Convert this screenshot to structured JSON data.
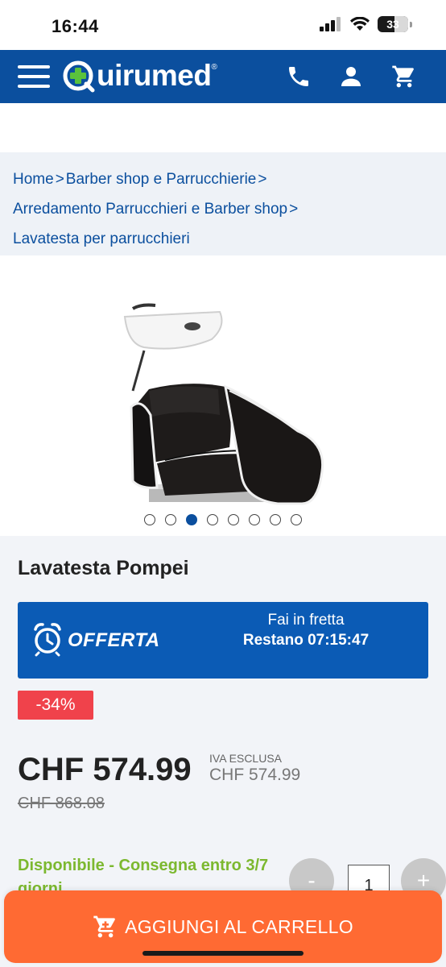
{
  "status_bar": {
    "time": "16:44",
    "battery": "33"
  },
  "header": {
    "logo_text": "uirumed",
    "logo_mark": "Q",
    "logo_reg": "®",
    "icons": [
      "menu-icon",
      "phone-icon",
      "user-icon",
      "cart-icon"
    ]
  },
  "breadcrumb": {
    "items": [
      {
        "label": "Home"
      },
      {
        "label": "Barber shop e Parrucchierie"
      },
      {
        "label": "Arredamento Parrucchieri e Barber shop"
      },
      {
        "label": "Lavatesta per parrucchieri"
      }
    ],
    "separator": ">"
  },
  "gallery": {
    "image": "salon-shampoo-chair",
    "slide_count": 8,
    "active_slide": 3
  },
  "product": {
    "title": "Lavatesta Pompei",
    "offer": {
      "label": "OFFERTA",
      "hurry": "Fai in fretta",
      "timer": "Restano 07:15:47"
    },
    "discount": "-34%",
    "price": "CHF 574.99",
    "vat_label": "IVA ESCLUSA",
    "vat_price": "CHF 574.99",
    "old_price": "CHF 868.08",
    "availability": "Disponibile - Consegna entro 3/7 giorni",
    "quantity": "1",
    "qty_minus": "-",
    "qty_plus": "+"
  },
  "cart_button": {
    "label": "AGGIUNGI AL CARRELLO"
  },
  "colors": {
    "brand_blue": "#0b4f9e",
    "offer_blue": "#0b5bb5",
    "discount_red": "#f0424b",
    "cta_orange": "#ff6a33",
    "available_green": "#7cb82f"
  }
}
